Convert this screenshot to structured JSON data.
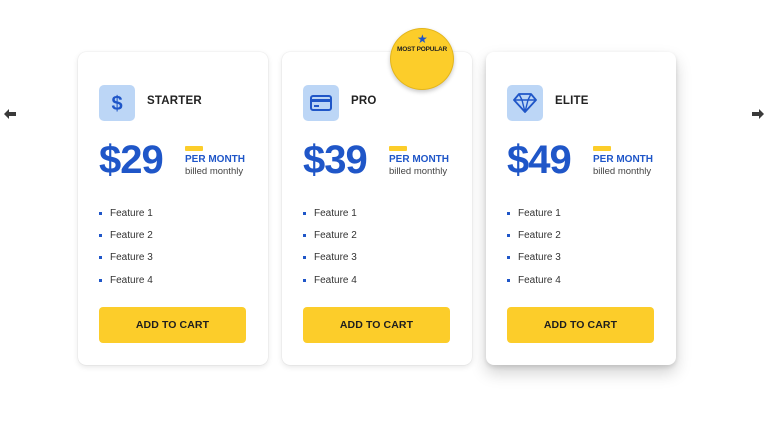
{
  "navigation": {
    "prev_icon": "arrow-left-icon",
    "next_icon": "arrow-right-icon"
  },
  "badge": {
    "label": "MOST POPULAR",
    "icon": "star-icon"
  },
  "colors": {
    "accent_yellow": "#fccd2a",
    "brand_blue": "#1f56c8",
    "icon_bg": "#bcd6f6"
  },
  "plans": [
    {
      "name": "STARTER",
      "icon": "dollar-icon",
      "price": "$29",
      "period": "PER MONTH",
      "billing": "billed monthly",
      "features": [
        "Feature 1",
        "Feature 2",
        "Feature 3",
        "Feature 4"
      ],
      "cta": "ADD TO CART"
    },
    {
      "name": "PRO",
      "icon": "credit-card-icon",
      "price": "$39",
      "period": "PER MONTH",
      "billing": "billed monthly",
      "features": [
        "Feature 1",
        "Feature 2",
        "Feature 3",
        "Feature 4"
      ],
      "cta": "ADD TO CART"
    },
    {
      "name": "ELITE",
      "icon": "diamond-icon",
      "price": "$49",
      "period": "PER MONTH",
      "billing": "billed monthly",
      "features": [
        "Feature 1",
        "Feature 2",
        "Feature 3",
        "Feature 4"
      ],
      "cta": "ADD TO CART"
    }
  ]
}
